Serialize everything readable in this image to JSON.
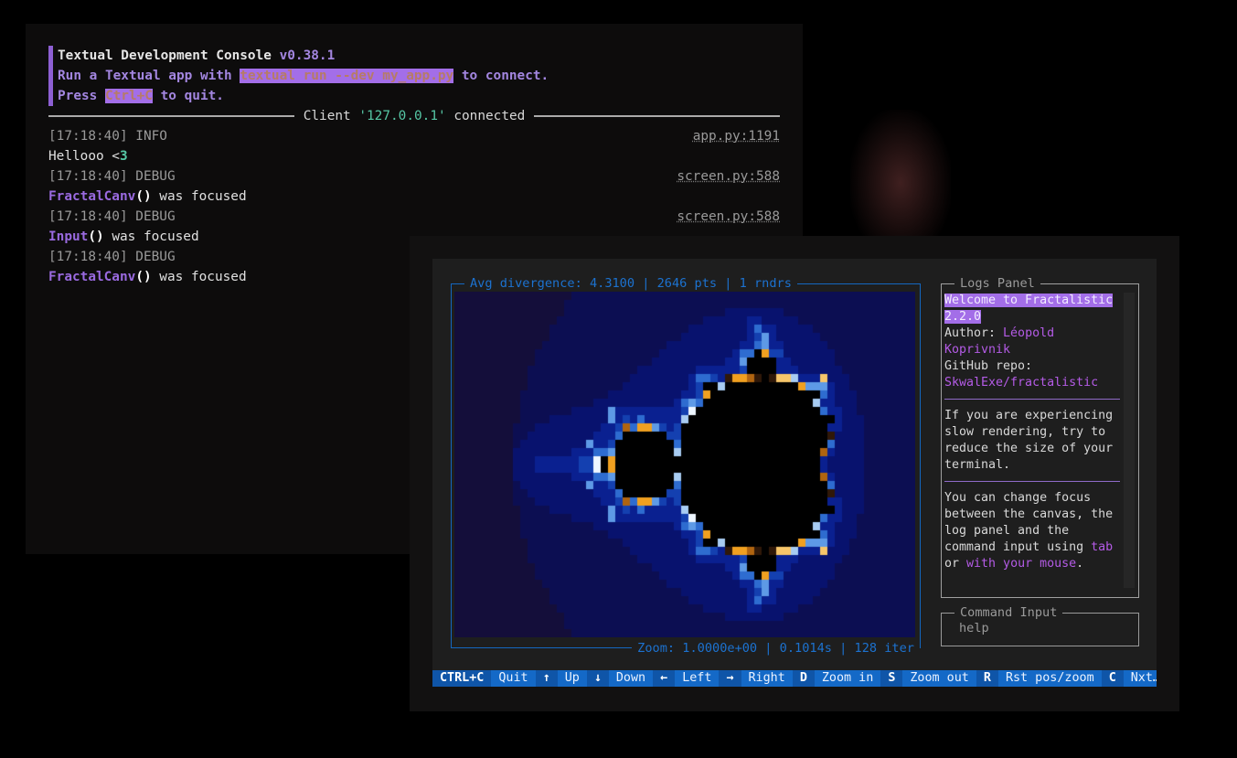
{
  "console": {
    "banner": {
      "title": "Textual Development Console",
      "version": "v0.38.1",
      "line2_pre": "Run a Textual app with ",
      "line2_cmd": "textual run --dev my_app.py",
      "line2_post": " to connect.",
      "line3_pre": "Press ",
      "line3_key": "Ctrl+C",
      "line3_post": " to quit."
    },
    "client": {
      "pre": "Client ",
      "ip": "'127.0.0.1'",
      "post": " connected"
    },
    "logs": [
      {
        "meta": "[17:18:40] INFO",
        "src": "app.py:1191",
        "msg_pre": "Hellooo <",
        "msg_num": "3"
      },
      {
        "meta": "[17:18:40] DEBUG",
        "src": "screen.py:588",
        "cls": "FractalCanv",
        "par": "()",
        "msg": " was focused"
      },
      {
        "meta": "[17:18:40] DEBUG",
        "src": "screen.py:588",
        "cls": "Input",
        "par": "()",
        "msg": " was focused"
      },
      {
        "meta": "[17:18:40] DEBUG",
        "cls": "FractalCanv",
        "par": "()",
        "msg": " was focused"
      }
    ]
  },
  "app": {
    "canvas_title": "Avg divergence: 4.3100 | 2646 pts | 1 rndrs",
    "canvas_subtitle": "Zoom: 1.0000e+00 | 0.1014s | 128 iter",
    "logs_panel": {
      "title": "Logs Panel",
      "welcome": "Welcome to Fractalistic 2.2.0",
      "author_label": "Author: ",
      "author": "Léopold Koprivnik",
      "repo_label": "GitHub repo:",
      "repo": "SkwalExe/fractalistic",
      "tip1": "If you are experiencing slow rendering, try to reduce the size of your terminal.",
      "tip2_pre": "You can change focus between the canvas, the log panel and the command input using ",
      "tip2_key": "tab",
      "tip2_mid": " or ",
      "tip2_mouse": "with your mouse",
      "tip2_end": "."
    },
    "command_input": {
      "title": "Command Input",
      "placeholder": "help"
    },
    "footer": [
      {
        "key": "CTRL+C",
        "desc": "Quit"
      },
      {
        "key": "↑",
        "desc": "Up"
      },
      {
        "key": "↓",
        "desc": "Down"
      },
      {
        "key": "←",
        "desc": "Left"
      },
      {
        "key": "→",
        "desc": "Right"
      },
      {
        "key": "D",
        "desc": "Zoom in"
      },
      {
        "key": "S",
        "desc": "Zoom out"
      },
      {
        "key": "R",
        "desc": "Rst pos/zoom"
      },
      {
        "key": "C",
        "desc": "Nxt…"
      }
    ]
  },
  "colors": {
    "accent_purple": "#a36ee8",
    "canvas_border": "#1467c0",
    "footer_blue": "#1469c7",
    "ip_green": "#56c7a5"
  }
}
